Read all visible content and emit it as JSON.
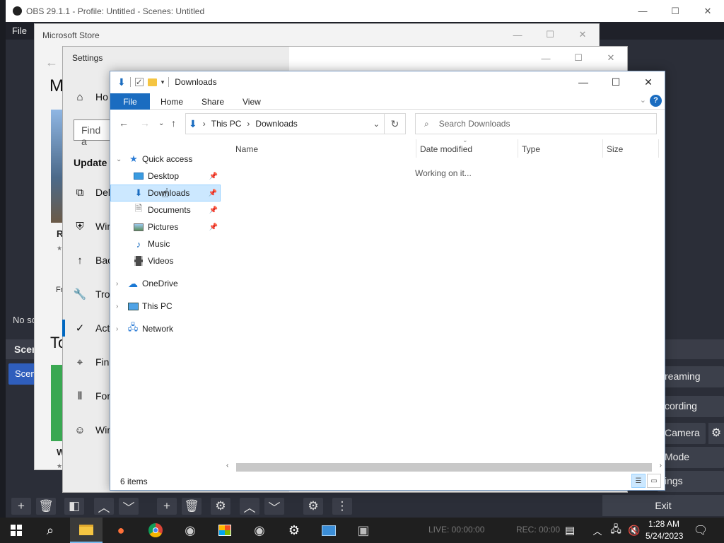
{
  "obs": {
    "title": "OBS 29.1.1 - Profile: Untitled - Scenes: Untitled",
    "menu_file": "File",
    "no_source": "No so",
    "scenes_head": "Scen",
    "scene_item": "Scen",
    "controls": {
      "streaming": "reaming",
      "recording": "cording",
      "camera": "Camera",
      "mode": "Mode",
      "settings": "ings",
      "exit": "Exit"
    }
  },
  "store": {
    "title": "Microsoft Store",
    "big_letter": "M",
    "r_letter": "R",
    "fr_text": "Fr",
    "to_text": "To",
    "w_letter": "W",
    "star": "★"
  },
  "settings": {
    "title": "Settings",
    "home": "Ho",
    "find": "Find a",
    "update": "Update",
    "items": [
      {
        "label": "Del",
        "icon": "delivery-icon"
      },
      {
        "label": "Wir",
        "icon": "shield-icon"
      },
      {
        "label": "Bac",
        "icon": "backup-icon"
      },
      {
        "label": "Tro",
        "icon": "wrench-icon"
      },
      {
        "label": "Act",
        "icon": "check-circle-icon"
      },
      {
        "label": "Fin",
        "icon": "find-device-icon"
      },
      {
        "label": "For",
        "icon": "developer-icon"
      },
      {
        "label": "Wir",
        "icon": "insider-icon"
      }
    ]
  },
  "explorer": {
    "title": "Downloads",
    "tabs": {
      "file": "File",
      "home": "Home",
      "share": "Share",
      "view": "View"
    },
    "address": {
      "this_pc": "This PC",
      "downloads": "Downloads"
    },
    "search_placeholder": "Search Downloads",
    "nav": {
      "quick_access": "Quick access",
      "desktop": "Desktop",
      "downloads": "Downloads",
      "documents": "Documents",
      "pictures": "Pictures",
      "music": "Music",
      "videos": "Videos",
      "onedrive": "OneDrive",
      "this_pc": "This PC",
      "network": "Network"
    },
    "columns": {
      "name": "Name",
      "date": "Date modified",
      "type": "Type",
      "size": "Size"
    },
    "working": "Working on it...",
    "status": "6 items"
  },
  "taskbar": {
    "live": "LIVE: 00:00:00",
    "rec": "REC: 00:00",
    "time": "1:28 AM",
    "date": "5/24/2023"
  },
  "colors": {
    "accent": "#1a6cc0",
    "selection": "#cce8ff",
    "obs_bg": "#2b2e38"
  }
}
